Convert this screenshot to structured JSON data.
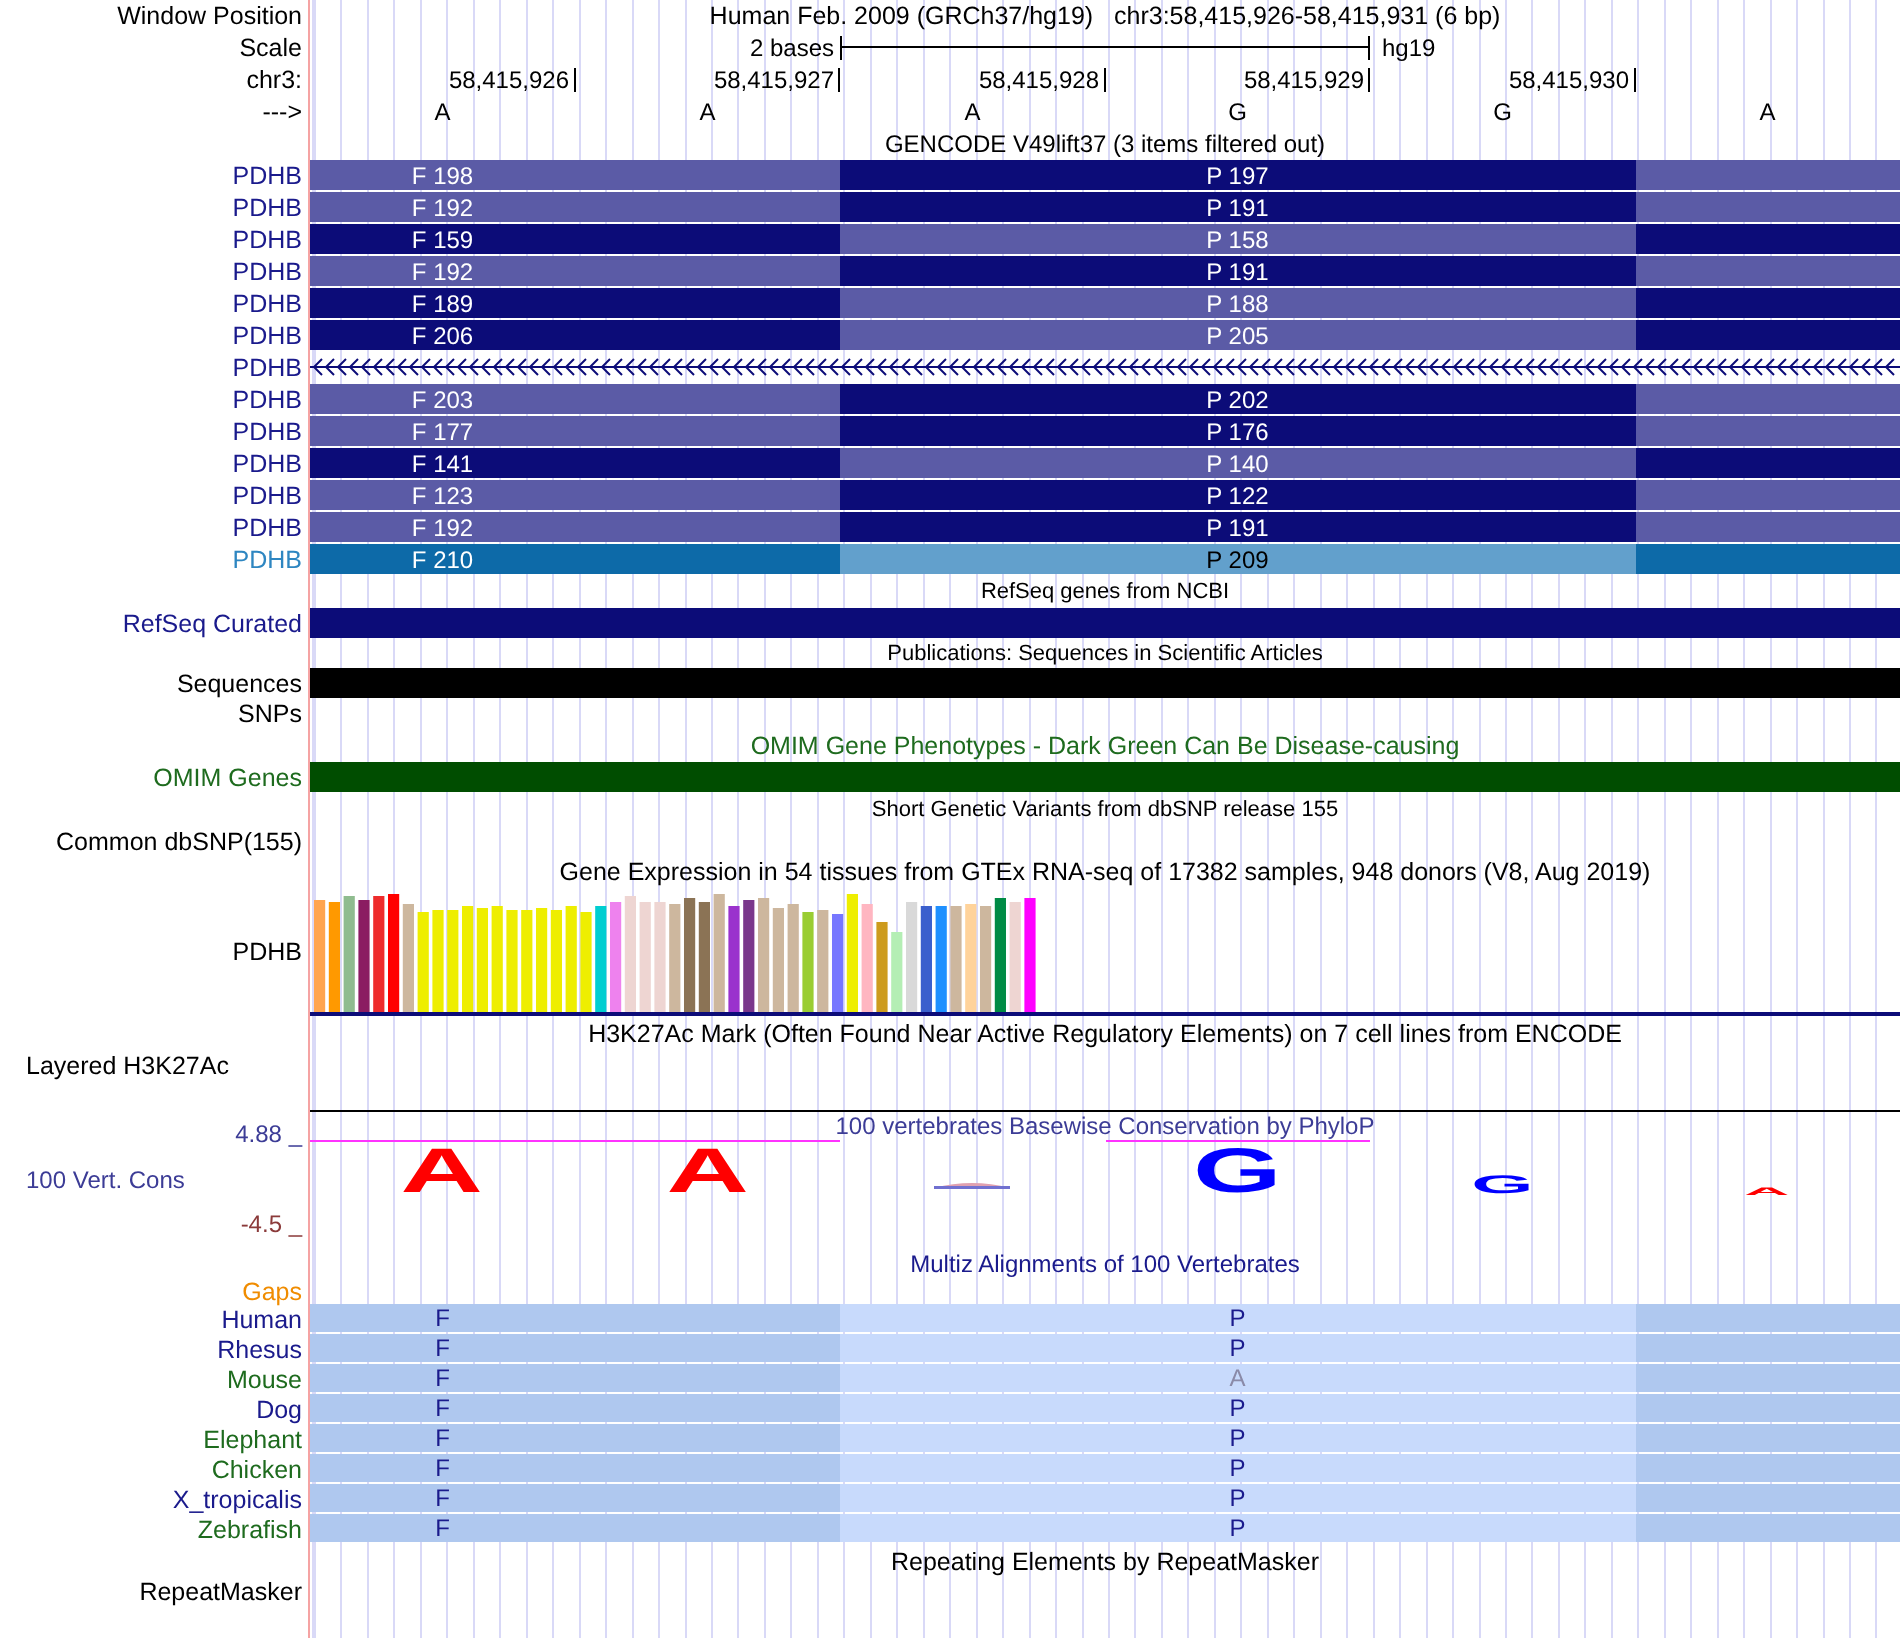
{
  "position": {
    "label": "Window Position",
    "assembly": "Human Feb. 2009 (GRCh37/hg19)",
    "range": "chr3:58,415,926-58,415,931 (6 bp)"
  },
  "scale": {
    "label": "Scale",
    "span": "2 bases",
    "db": "hg19"
  },
  "ruler": {
    "label": "chr3:",
    "ticks": [
      "58,415,926",
      "58,415,927",
      "58,415,928",
      "58,415,929",
      "58,415,930"
    ]
  },
  "bases": {
    "label": "--->",
    "letters": [
      "A",
      "A",
      "A",
      "G",
      "G",
      "A"
    ]
  },
  "gencode": {
    "title": "GENCODE V49lift37 (3 items filtered out)",
    "rows": [
      {
        "label": "PDHB",
        "color": "#1a1a8c",
        "kind": "exon",
        "segments": [
          {
            "text": "F 198",
            "color": "#5b5ba6"
          },
          {
            "text": "P 197",
            "color": "#0c0c78"
          },
          {
            "color": "#5b5ba6"
          }
        ]
      },
      {
        "label": "PDHB",
        "color": "#1a1a8c",
        "kind": "exon",
        "segments": [
          {
            "text": "F 192",
            "color": "#5b5ba6"
          },
          {
            "text": "P 191",
            "color": "#0c0c78"
          },
          {
            "color": "#5b5ba6"
          }
        ]
      },
      {
        "label": "PDHB",
        "color": "#1a1a8c",
        "kind": "exon",
        "segments": [
          {
            "text": "F 159",
            "color": "#0c0c78"
          },
          {
            "text": "P 158",
            "color": "#5b5ba6"
          },
          {
            "color": "#0c0c78"
          }
        ]
      },
      {
        "label": "PDHB",
        "color": "#1a1a8c",
        "kind": "exon",
        "segments": [
          {
            "text": "F 192",
            "color": "#5b5ba6"
          },
          {
            "text": "P 191",
            "color": "#0c0c78"
          },
          {
            "color": "#5b5ba6"
          }
        ]
      },
      {
        "label": "PDHB",
        "color": "#1a1a8c",
        "kind": "exon",
        "segments": [
          {
            "text": "F 189",
            "color": "#0c0c78"
          },
          {
            "text": "P 188",
            "color": "#5b5ba6"
          },
          {
            "color": "#0c0c78"
          }
        ]
      },
      {
        "label": "PDHB",
        "color": "#1a1a8c",
        "kind": "exon",
        "segments": [
          {
            "text": "F 206",
            "color": "#0c0c78"
          },
          {
            "text": "P 205",
            "color": "#5b5ba6"
          },
          {
            "color": "#0c0c78"
          }
        ]
      },
      {
        "label": "PDHB",
        "color": "#1a1a8c",
        "kind": "intron"
      },
      {
        "label": "PDHB",
        "color": "#1a1a8c",
        "kind": "exon",
        "segments": [
          {
            "text": "F 203",
            "color": "#5b5ba6"
          },
          {
            "text": "P 202",
            "color": "#0c0c78"
          },
          {
            "color": "#5b5ba6"
          }
        ]
      },
      {
        "label": "PDHB",
        "color": "#1a1a8c",
        "kind": "exon",
        "segments": [
          {
            "text": "F 177",
            "color": "#5b5ba6"
          },
          {
            "text": "P 176",
            "color": "#0c0c78"
          },
          {
            "color": "#5b5ba6"
          }
        ]
      },
      {
        "label": "PDHB",
        "color": "#1a1a8c",
        "kind": "exon",
        "segments": [
          {
            "text": "F 141",
            "color": "#0c0c78"
          },
          {
            "text": "P 140",
            "color": "#5b5ba6"
          },
          {
            "color": "#0c0c78"
          }
        ]
      },
      {
        "label": "PDHB",
        "color": "#1a1a8c",
        "kind": "exon",
        "segments": [
          {
            "text": "F 123",
            "color": "#5b5ba6"
          },
          {
            "text": "P 122",
            "color": "#0c0c78"
          },
          {
            "color": "#5b5ba6"
          }
        ]
      },
      {
        "label": "PDHB",
        "color": "#1a1a8c",
        "kind": "exon",
        "segments": [
          {
            "text": "F 192",
            "color": "#5b5ba6"
          },
          {
            "text": "P 191",
            "color": "#0c0c78"
          },
          {
            "color": "#5b5ba6"
          }
        ]
      },
      {
        "label": "PDHB",
        "color": "#2e86c1",
        "kind": "exon",
        "segments": [
          {
            "text": "F 210",
            "color": "#0d6aa8"
          },
          {
            "text": "P 209",
            "color": "#62a0cc"
          },
          {
            "color": "#0d6aa8"
          }
        ]
      }
    ]
  },
  "refseq": {
    "title": "RefSeq genes from NCBI",
    "label": "RefSeq Curated",
    "color": "#1a1a8c",
    "bar": {
      "color": "#0c0c78"
    }
  },
  "publications": {
    "title": "Publications: Sequences in Scientific Articles",
    "label": "Sequences",
    "color": "#000000",
    "bar": {
      "color": "#000000"
    }
  },
  "snps": {
    "label": "SNPs"
  },
  "omim": {
    "title": "OMIM Gene Phenotypes - Dark Green Can Be Disease-causing",
    "label": "OMIM Genes",
    "color": "#1e6b1e",
    "bar": {
      "color": "#004d00"
    }
  },
  "dbsnp": {
    "title": "Short Genetic Variants from dbSNP release 155",
    "label": "Common dbSNP(155)"
  },
  "gtex": {
    "title": "Gene Expression in 54 tissues from GTEx RNA-seq of 17382 samples, 948 donors (V8, Aug 2019)",
    "label": "PDHB"
  },
  "h3k27ac": {
    "title": "H3K27Ac Mark (Often Found Near Active Regulatory Elements) on 7 cell lines from ENCODE",
    "label": "Layered H3K27Ac"
  },
  "conservation": {
    "title": "100 vertebrates Basewise Conservation by PhyloP",
    "label": "100 Vert. Cons",
    "max": "4.88 _",
    "min": "-4.5 _",
    "letters": [
      {
        "base": "A",
        "color": "#ff0000",
        "kind": "tall"
      },
      {
        "base": "A",
        "color": "#ff0000",
        "kind": "tall"
      },
      {
        "kind": "mixed"
      },
      {
        "base": "G",
        "color": "#0000ff",
        "kind": "tall"
      },
      {
        "base": "G",
        "color": "#0000ff",
        "kind": "medium"
      },
      {
        "base": "A",
        "color": "#ff0000",
        "kind": "flat"
      }
    ]
  },
  "multiz": {
    "title": "Multiz Alignments of 100 Vertebrates",
    "gaps_label": "Gaps",
    "species": [
      {
        "name": "Human",
        "color": "#1a1a8c",
        "cells": [
          {
            "text": "F",
            "differs": false
          },
          {
            "text": "P",
            "differs": false
          }
        ]
      },
      {
        "name": "Rhesus",
        "color": "#1a1a8c",
        "cells": [
          {
            "text": "F",
            "differs": false
          },
          {
            "text": "P",
            "differs": false
          }
        ]
      },
      {
        "name": "Mouse",
        "color": "#1e6b1e",
        "cells": [
          {
            "text": "F",
            "differs": false
          },
          {
            "text": "A",
            "differs": true
          }
        ]
      },
      {
        "name": "Dog",
        "color": "#1a1a8c",
        "cells": [
          {
            "text": "F",
            "differs": false
          },
          {
            "text": "P",
            "differs": false
          }
        ]
      },
      {
        "name": "Elephant",
        "color": "#1e6b1e",
        "cells": [
          {
            "text": "F",
            "differs": false
          },
          {
            "text": "P",
            "differs": false
          }
        ]
      },
      {
        "name": "Chicken",
        "color": "#1e6b1e",
        "cells": [
          {
            "text": "F",
            "differs": false
          },
          {
            "text": "P",
            "differs": false
          }
        ]
      },
      {
        "name": "X_tropicalis",
        "color": "#1a1a8c",
        "cells": [
          {
            "text": "F",
            "differs": false
          },
          {
            "text": "P",
            "differs": false
          }
        ]
      },
      {
        "name": "Zebrafish",
        "color": "#1e6b1e",
        "cells": [
          {
            "text": "F",
            "differs": false
          },
          {
            "text": "P",
            "differs": false
          }
        ]
      }
    ]
  },
  "repeatmasker": {
    "title": "Repeating Elements by RepeatMasker",
    "label": "RepeatMasker"
  }
}
